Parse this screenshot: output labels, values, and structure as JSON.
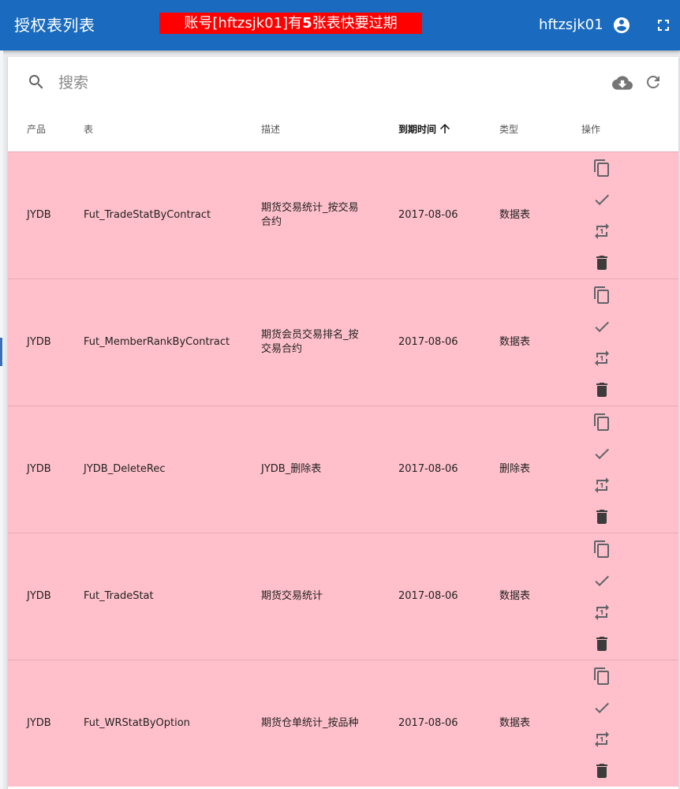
{
  "appbar": {
    "title": "授权表列表",
    "alert_prefix": "账号[hftzsjk01]有",
    "alert_count": "5",
    "alert_suffix": "张表快要过期",
    "username": "hftzsjk01",
    "color": "#1a6bbf",
    "alert_color": "#ff0000"
  },
  "toolbar": {
    "search_placeholder": "搜索",
    "search_value": "",
    "icons": [
      "search-icon",
      "cloud-download-icon",
      "refresh-icon"
    ]
  },
  "table": {
    "columns": [
      {
        "label": "产品"
      },
      {
        "label": "表"
      },
      {
        "label": "描述"
      },
      {
        "label": "到期时间",
        "sorted": "ascending"
      },
      {
        "label": "类型"
      },
      {
        "label": "操作"
      }
    ],
    "row_highlight_color": "#ffc0cb",
    "rows": [
      {
        "product": "JYDB",
        "table": "Fut_TradeStatByContract",
        "description": "期货交易统计_按交易合约",
        "expiry": "2017-08-06",
        "type": "数据表"
      },
      {
        "product": "JYDB",
        "table": "Fut_MemberRankByContract",
        "description": "期货会员交易排名_按交易合约",
        "expiry": "2017-08-06",
        "type": "数据表"
      },
      {
        "product": "JYDB",
        "table": "JYDB_DeleteRec",
        "description": "JYDB_删除表",
        "expiry": "2017-08-06",
        "type": "删除表"
      },
      {
        "product": "JYDB",
        "table": "Fut_TradeStat",
        "description": "期货交易统计",
        "expiry": "2017-08-06",
        "type": "数据表"
      },
      {
        "product": "JYDB",
        "table": "Fut_WRStatByOption",
        "description": "期货仓单统计_按品种",
        "expiry": "2017-08-06",
        "type": "数据表"
      }
    ],
    "row_actions": [
      "copy-icon",
      "check-icon",
      "swap-icon",
      "delete-icon"
    ]
  }
}
